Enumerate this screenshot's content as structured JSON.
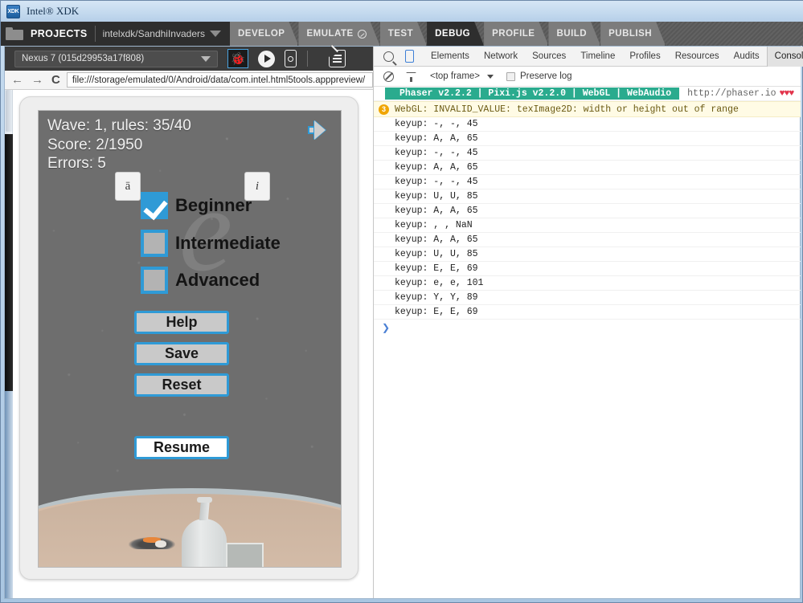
{
  "window": {
    "title": "Intel® XDK",
    "logo_text": "XDK"
  },
  "topbar": {
    "projects_label": "PROJECTS",
    "project_name": "intelxdk/SandhiInvaders",
    "folder_icon": "folder-icon",
    "caret_icon": "chevron-down-icon",
    "tabs": [
      {
        "label": "DEVELOP",
        "active": false,
        "badge": false
      },
      {
        "label": "EMULATE",
        "active": false,
        "badge": true
      },
      {
        "label": "TEST",
        "active": false,
        "badge": false
      },
      {
        "label": "DEBUG",
        "active": true,
        "badge": false
      },
      {
        "label": "PROFILE",
        "active": false,
        "badge": false
      },
      {
        "label": "BUILD",
        "active": false,
        "badge": false
      },
      {
        "label": "PUBLISH",
        "active": false,
        "badge": false
      }
    ]
  },
  "device_toolbar": {
    "device": "Nexus 7 (015d29953a17f808)",
    "caret_icon": "chevron-down-icon",
    "bug_icon": "bug-icon",
    "play_icon": "play-icon",
    "phone_icon": "phone-device-icon",
    "clear_icon": "clear-cache-icon"
  },
  "browser_bar": {
    "back_icon": "arrow-left-icon",
    "forward_icon": "arrow-right-icon",
    "reload_icon": "reload-icon",
    "back_glyph": "←",
    "forward_glyph": "→",
    "reload_glyph": "C",
    "url": "file:///storage/emulated/0/Android/data/com.intel.html5tools.apppreview/"
  },
  "game": {
    "hud": {
      "line1": "Wave: 1, rules: 35/40",
      "line2": "Score: 2/1950",
      "line3": "Errors: 5"
    },
    "watermark": "e",
    "speaker_icon": "speaker-icon",
    "mini_buttons": [
      {
        "label": "ā",
        "name": "accent-button"
      },
      {
        "label": "i",
        "name": "info-button"
      }
    ],
    "difficulty": [
      {
        "label": "Beginner",
        "checked": true
      },
      {
        "label": "Intermediate",
        "checked": false
      },
      {
        "label": "Advanced",
        "checked": false
      }
    ],
    "buttons": [
      {
        "label": "Help"
      },
      {
        "label": "Save"
      },
      {
        "label": "Reset"
      },
      {
        "label": "Resume"
      }
    ],
    "colors": {
      "accent": "#2f9ad6",
      "sky": "#6e6e6e",
      "ground": "#d6bda8"
    }
  },
  "devtools": {
    "search_icon": "search-icon",
    "device_mode_icon": "device-toggle-icon",
    "tabs": [
      {
        "label": "Elements",
        "active": false
      },
      {
        "label": "Network",
        "active": false
      },
      {
        "label": "Sources",
        "active": false
      },
      {
        "label": "Timeline",
        "active": false
      },
      {
        "label": "Profiles",
        "active": false
      },
      {
        "label": "Resources",
        "active": false
      },
      {
        "label": "Audits",
        "active": false
      },
      {
        "label": "Console",
        "active": true
      }
    ],
    "subbar": {
      "clear_icon": "clear-console-icon",
      "filter_icon": "filter-icon",
      "frame": "<top frame>",
      "frame_caret_icon": "chevron-down-icon",
      "preserve_log_label": "Preserve log",
      "preserve_log_checked": false
    },
    "console": {
      "banner": {
        "text": "Phaser v2.2.2 | Pixi.js v2.2.0 | WebGL | WebAudio",
        "url": "http://phaser.io",
        "hearts": "♥♥♥",
        "chip_color": "#2aab8e",
        "heart_color": "#e2344b"
      },
      "warning": {
        "count": "3",
        "text": "WebGL: INVALID_VALUE: texImage2D: width or height out of range"
      },
      "entries": [
        "keyup: -, -, 45",
        "keyup: A, A, 65",
        "keyup: -, -, 45",
        "keyup: A, A, 65",
        "keyup: -, -, 45",
        "keyup: U, U, 85",
        "keyup: A, A, 65",
        "keyup: , , NaN",
        "keyup: A, A, 65",
        "keyup: U, U, 85",
        "keyup: E, E, 69",
        "keyup: e, e, 101",
        "keyup: Y, Y, 89",
        "keyup: E, E, 69"
      ],
      "prompt_glyph": "❯"
    }
  }
}
